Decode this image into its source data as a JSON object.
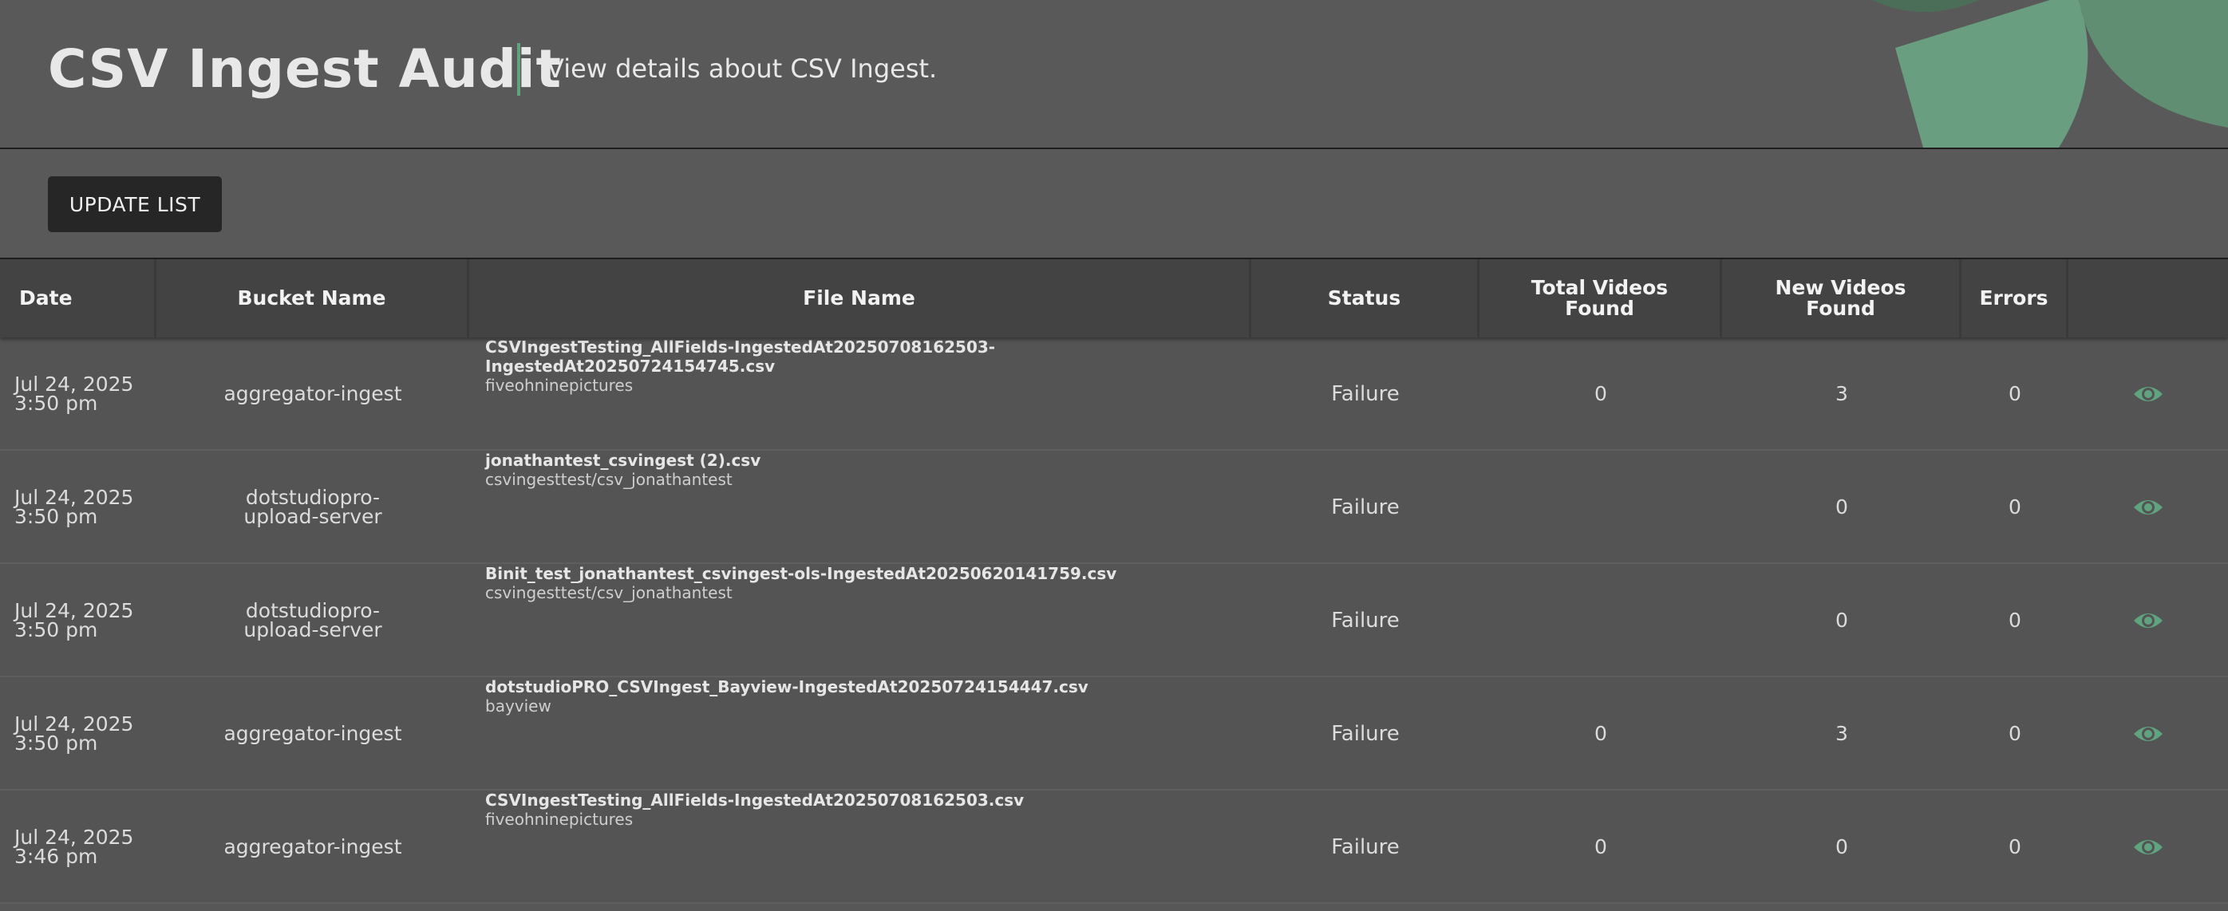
{
  "header": {
    "title": "CSV Ingest Audit",
    "subtitle": "View details about CSV Ingest.",
    "accent_color": "#5fa37f"
  },
  "toolbar": {
    "update_label": "UPDATE LIST"
  },
  "table": {
    "columns": {
      "date": "Date",
      "bucket": "Bucket Name",
      "file": "File Name",
      "status": "Status",
      "total": "Total Videos Found",
      "new": "New Videos Found",
      "errors": "Errors",
      "actions": ""
    },
    "rows": [
      {
        "date": "Jul 24, 2025 3:50 pm",
        "bucket": "aggregator-ingest",
        "file_name": "CSVIngestTesting_AllFields-IngestedAt20250708162503-IngestedAt20250724154745.csv",
        "file_path": "fiveohninepictures",
        "status": "Failure",
        "total": "0",
        "new": "3",
        "errors": "0",
        "action_icon": "eye-icon"
      },
      {
        "date": "Jul 24, 2025 3:50 pm",
        "bucket": "dotstudiopro-upload-server",
        "file_name": "jonathantest_csvingest (2).csv",
        "file_path": "csvingesttest/csv_jonathantest",
        "status": "Failure",
        "total": "",
        "new": "0",
        "errors": "0",
        "action_icon": "eye-icon"
      },
      {
        "date": "Jul 24, 2025 3:50 pm",
        "bucket": "dotstudiopro-upload-server",
        "file_name": "Binit_test_jonathantest_csvingest-ols-IngestedAt20250620141759.csv",
        "file_path": "csvingesttest/csv_jonathantest",
        "status": "Failure",
        "total": "",
        "new": "0",
        "errors": "0",
        "action_icon": "eye-icon"
      },
      {
        "date": "Jul 24, 2025 3:50 pm",
        "bucket": "aggregator-ingest",
        "file_name": "dotstudioPRO_CSVIngest_Bayview-IngestedAt20250724154447.csv",
        "file_path": "bayview",
        "status": "Failure",
        "total": "0",
        "new": "3",
        "errors": "0",
        "action_icon": "eye-icon"
      },
      {
        "date": "Jul 24, 2025 3:46 pm",
        "bucket": "aggregator-ingest",
        "file_name": "CSVIngestTesting_AllFields-IngestedAt20250708162503.csv",
        "file_path": "fiveohninepictures",
        "status": "Failure",
        "total": "0",
        "new": "0",
        "errors": "0",
        "action_icon": "eye-icon"
      }
    ]
  }
}
